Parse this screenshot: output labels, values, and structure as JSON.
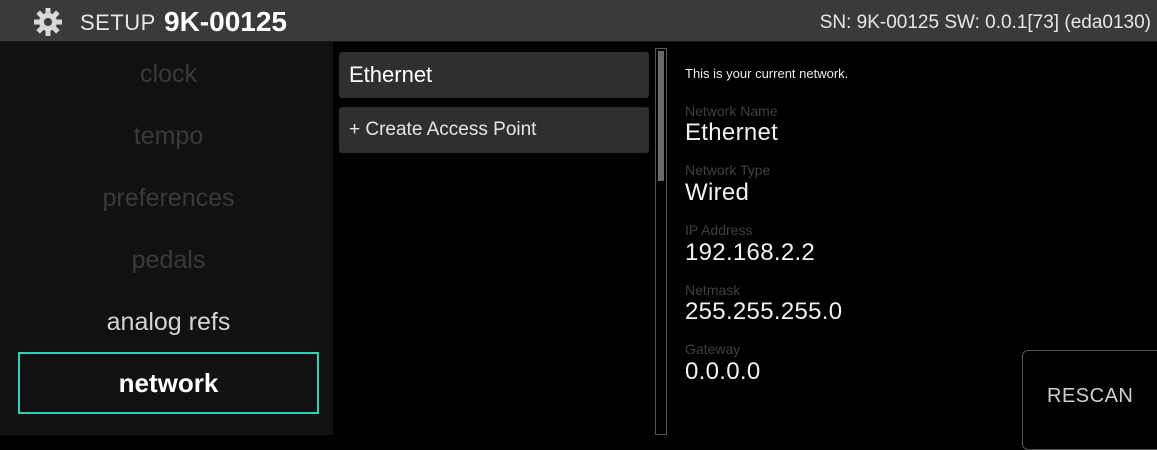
{
  "header": {
    "icon": "gear-icon",
    "setup_label": "SETUP",
    "device_name": "9K-00125",
    "sn_sw": "SN: 9K-00125 SW: 0.0.1[73] (eda0130)"
  },
  "sidebar": {
    "items": [
      {
        "label": "clock",
        "state": "dimmed"
      },
      {
        "label": "tempo",
        "state": "dimmed"
      },
      {
        "label": "preferences",
        "state": "dimmed"
      },
      {
        "label": "pedals",
        "state": "dimmed"
      },
      {
        "label": "analog refs",
        "state": "enabled"
      },
      {
        "label": "network",
        "state": "selected"
      }
    ],
    "accent_color": "#2bd4b6"
  },
  "networks": {
    "items": [
      "Ethernet",
      "+ Create Access Point"
    ]
  },
  "details": {
    "intro": "This is your current network.",
    "fields": [
      {
        "label": "Network Name",
        "value": "Ethernet"
      },
      {
        "label": "Network Type",
        "value": "Wired"
      },
      {
        "label": "IP Address",
        "value": "192.168.2.2"
      },
      {
        "label": "Netmask",
        "value": "255.255.255.0"
      },
      {
        "label": "Gateway",
        "value": "0.0.0.0"
      }
    ]
  },
  "rescan_label": "RESCAN"
}
